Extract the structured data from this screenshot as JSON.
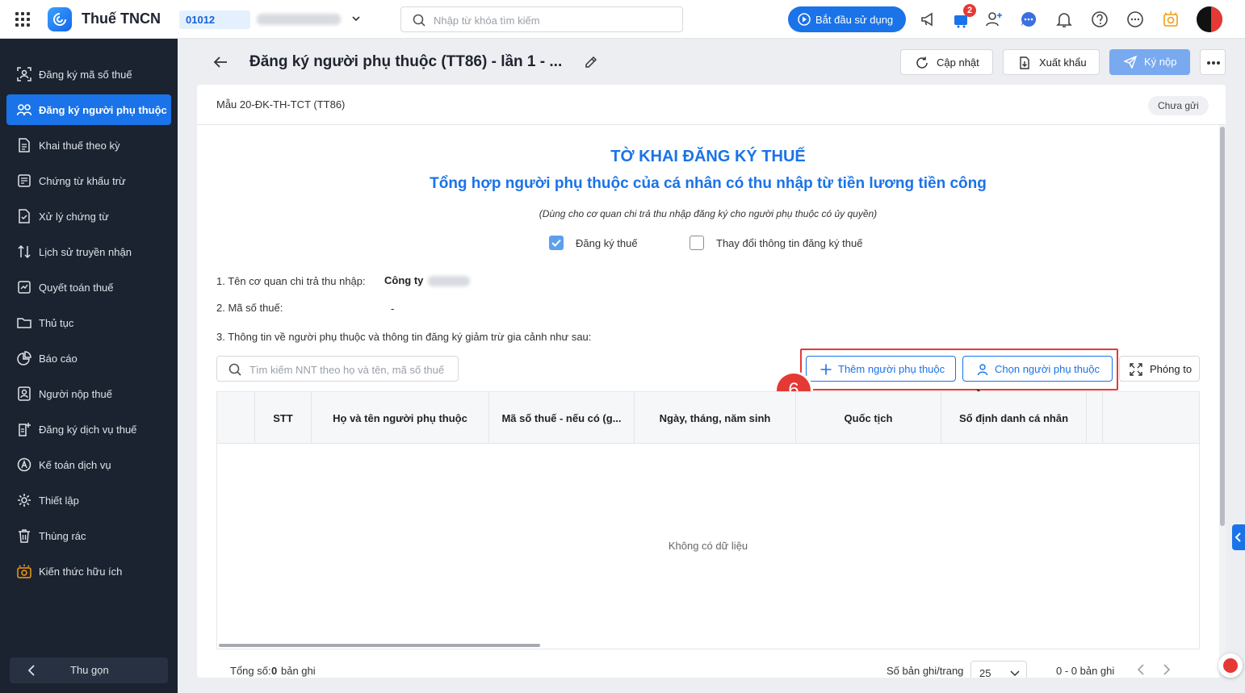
{
  "topbar": {
    "app_name": "Thuế TNCN",
    "org_code": "01012",
    "search_placeholder": "Nhập từ khóa tìm kiếm",
    "start_button": "Bắt đầu sử dụng",
    "cart_badge": "2",
    "accent_color": "#1a73e8"
  },
  "sidebar": {
    "items": [
      {
        "label": "Đăng ký mã số thuế",
        "icon": "id-scan-icon"
      },
      {
        "label": "Đăng ký người phụ thuộc",
        "icon": "users-icon",
        "active": true
      },
      {
        "label": "Khai thuế theo kỳ",
        "icon": "document-icon"
      },
      {
        "label": "Chứng từ khấu trừ",
        "icon": "receipt-icon"
      },
      {
        "label": "Xử lý chứng từ",
        "icon": "document-check-icon"
      },
      {
        "label": "Lịch sử truyền nhận",
        "icon": "transfer-icon"
      },
      {
        "label": "Quyết toán thuế",
        "icon": "settlement-icon"
      },
      {
        "label": "Thủ tục",
        "icon": "folder-icon"
      },
      {
        "label": "Báo cáo",
        "icon": "pie-chart-icon"
      },
      {
        "label": "Người nộp thuế",
        "icon": "taxpayer-icon"
      },
      {
        "label": "Đăng ký dịch vụ thuế",
        "icon": "service-register-icon"
      },
      {
        "label": "Kế toán dịch vụ",
        "icon": "accounting-icon"
      },
      {
        "label": "Thiết lập",
        "icon": "gear-icon"
      },
      {
        "label": "Thùng rác",
        "icon": "trash-icon"
      },
      {
        "label": "Kiến thức hữu ích",
        "icon": "knowledge-icon"
      }
    ],
    "collapse_label": "Thu gọn"
  },
  "header": {
    "title": "Đăng ký người phụ thuộc (TT86) - lần 1 - ...",
    "refresh_label": "Cập nhật",
    "export_label": "Xuất khẩu",
    "submit_label": "Ký nộp"
  },
  "form": {
    "code": "Mẫu 20-ĐK-TH-TCT (TT86)",
    "status": "Chưa gửi",
    "title": "TỜ KHAI ĐĂNG KÝ THUẾ",
    "subtitle": "Tổng hợp người phụ thuộc của cá nhân có thu nhập từ tiền lương tiền công",
    "note": "(Dùng cho cơ quan chi trả thu nhập đăng ký cho người phụ thuộc có ủy quyền)",
    "checkbox_register": {
      "label": "Đăng ký thuế",
      "checked": true
    },
    "checkbox_change": {
      "label": "Thay đổi thông tin đăng ký thuế",
      "checked": false
    },
    "field1_label": "1. Tên cơ quan chi trả thu nhập:",
    "field1_value": "Công ty",
    "field2_label": "2. Mã số thuế:",
    "field2_value": "-",
    "field3_label": "3. Thông tin về người phụ thuộc và thông tin đăng ký giảm trừ gia cảnh như sau:",
    "search_placeholder": "Tìm kiếm NNT theo họ và tên, mã số thuế",
    "add_button": "Thêm người phụ thuộc",
    "choose_button": "Chọn người phụ thuộc",
    "zoom_button": "Phóng to",
    "step_number": "6"
  },
  "table": {
    "columns": [
      "",
      "STT",
      "Họ và tên người phụ thuộc",
      "Mã số thuế - nếu có (g...",
      "Ngày, tháng, năm sinh",
      "Quốc tịch",
      "Số định danh cá nhân",
      "",
      ""
    ],
    "empty_text": "Không có dữ liệu",
    "total_label": "Tổng số:",
    "total_value": "0",
    "total_unit": "bản ghi",
    "page_size_label": "Số bản ghi/trang",
    "page_size_value": "25",
    "range_text": "0 - 0 bản ghi"
  }
}
